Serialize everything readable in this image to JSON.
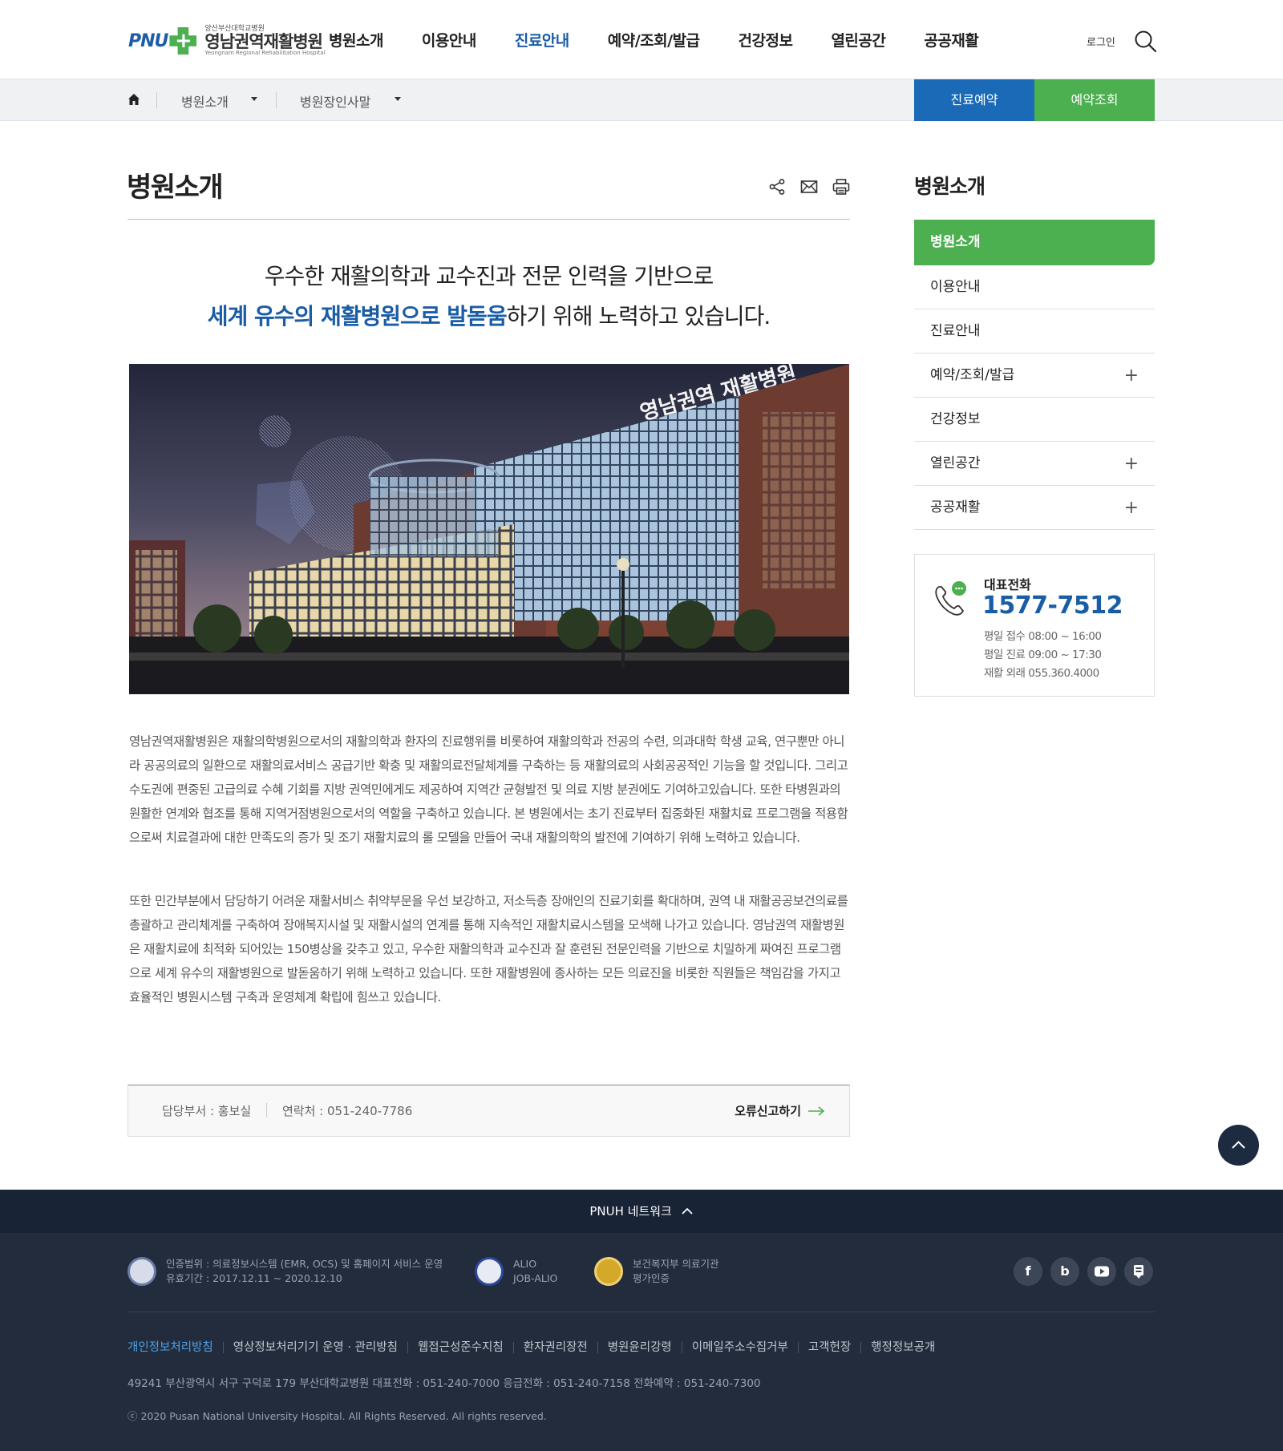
{
  "header": {
    "logo_mark": "PNU",
    "logo_sup": "양산부산대학교병원",
    "logo_main": "영남권역재활병원",
    "logo_en": "Yeongnam Regional Rehabilitation Hospital",
    "nav": [
      "병원소개",
      "이용안내",
      "진료안내",
      "예약/조회/발급",
      "건강정보",
      "열린공간",
      "공공재활"
    ],
    "nav_active_index": 2,
    "login": "로그인"
  },
  "subbar": {
    "crumb1": "병원소개",
    "crumb2": "병원장인사말",
    "btn_reserve": "진료예약",
    "btn_check": "예약조회"
  },
  "main": {
    "title": "병원소개",
    "lead_line1": "우수한 재활의학과 교수진과 전문 인력을 기반으로",
    "lead_highlight": "세계 유수의 재활병원으로 발돋움",
    "lead_rest": "하기 위해 노력하고 있습니다.",
    "photo_sign": "영남권역 재활병원",
    "para1": "영남권역재활병원은 재활의학병원으로서의 재활의학과 환자의 진료행위를 비롯하여 재활의학과 전공의 수련, 의과대학 학생 교육, 연구뿐만 아니라 공공의료의 일환으로 재활의료서비스 공급기반 확충 및 재활의료전달체계를 구축하는 등 재활의료의 사회공공적인 기능을 할 것입니다. 그리고 수도권에 편중된 고급의료 수혜 기회를 지방 권역민에게도 제공하여 지역간 균형발전 및 의료 지방 분권에도 기여하고있습니다. 또한 타병원과의 원활한 연계와 협조를 통해 지역거점병원으로서의 역할을 구축하고 있습니다. 본 병원에서는 초기 진료부터 집중화된 재활치료 프로그램을 적용함으로써 치료결과에 대한 만족도의 증가 및 조기 재활치료의 롤 모델을 만들어 국내 재활의학의 발전에 기여하기 위해 노력하고 있습니다.",
    "para2": "또한 민간부분에서 담당하기 어려운 재활서비스 취약부문을 우선 보강하고, 저소득층 장애인의 진료기회를 확대하며, 권역 내 재활공공보건의료를 총괄하고 관리체계를 구축하여 장애복지시설 및 재활시설의 연계를 통해 지속적인 재활치료시스템을 모색해 나가고 있습니다. 영남권역 재활병원은 재활치료에 최적화 되어있는 150병상을 갖추고 있고, 우수한 재활의학과 교수진과 잘 훈련된 전문인력을 기반으로 치밀하게 짜여진 프로그램으로 세계 유수의 재활병원으로 발돋움하기 위해 노력하고 있습니다. 또한 재활병원에 종사하는 모든 의료진을 비롯한 직원들은 책임감을 가지고 효율적인 병원시스템 구축과 운영체계 확립에 힘쓰고 있습니다.",
    "dept": "담당부서 : 홍보실",
    "tel": "연락처 : 051-240-7786",
    "report": "오류신고하기"
  },
  "side": {
    "title": "병원소개",
    "items": [
      {
        "label": "병원소개",
        "active": true,
        "expandable": false
      },
      {
        "label": "이용안내",
        "active": false,
        "expandable": false
      },
      {
        "label": "진료안내",
        "active": false,
        "expandable": false
      },
      {
        "label": "예약/조회/발급",
        "active": false,
        "expandable": true
      },
      {
        "label": "건강정보",
        "active": false,
        "expandable": false
      },
      {
        "label": "열린공간",
        "active": false,
        "expandable": true
      },
      {
        "label": "공공재활",
        "active": false,
        "expandable": true
      }
    ],
    "call_label": "대표전화",
    "call_number": "1577-7512",
    "hours1": "평일 접수 08:00 ~ 16:00",
    "hours2": "평일 진료 09:00 ~ 17:30",
    "hours3": "재활 외래 055.360.4000"
  },
  "footer": {
    "network": "PNUH 네트워크",
    "cert1_line1": "인증범위 : 의료정보시스템 (EMR, OCS) 및 홈페이지 서비스 운영",
    "cert1_line2": "유효기간 : 2017.12.11 ~ 2020.12.10",
    "cert2_line1": "ALIO",
    "cert2_line2": "JOB-ALIO",
    "cert3_line1": "보건복지부 의료기관",
    "cert3_line2": "평가인증",
    "sns": [
      "f",
      "b"
    ],
    "links": [
      "개인정보처리방침",
      "영상정보처리기기 운영 · 관리방침",
      "웹접근성준수지침",
      "환자권리장전",
      "병원윤리강령",
      "이메일주소수집거부",
      "고객헌장",
      "행정정보공개"
    ],
    "address": "49241 부산광역시 서구 구덕로 179 부산대학교병원   대표전화 : 051-240-7000   응급전화 : 051-240-7158   전화예약 : 051-240-7300",
    "copyright": "ⓒ 2020 Pusan National University Hospital. All Rights Reserved. All rights reserved.",
    "colors": {
      "footer_bg": "#222c3d",
      "net_bar": "#182336",
      "accent_blue": "#1a5da6",
      "accent_green": "#4caf50"
    }
  }
}
